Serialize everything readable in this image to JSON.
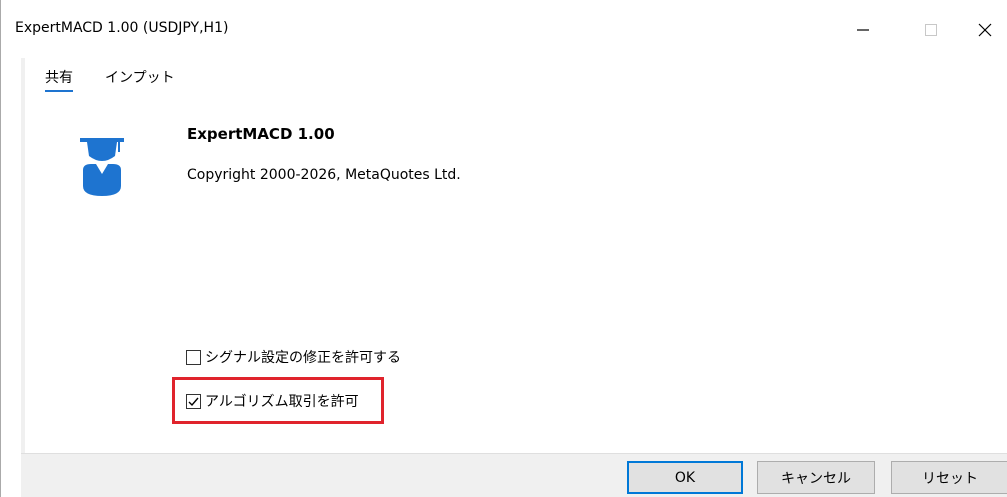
{
  "window": {
    "title": "ExpertMACD 1.00 (USDJPY,H1)",
    "controls": {
      "minimize": "—",
      "maximize": "☐",
      "close": "✕"
    }
  },
  "tabs": [
    {
      "label": "共有",
      "active": true
    },
    {
      "label": "インプット",
      "active": false
    }
  ],
  "expert": {
    "icon": "expert-advisor-icon",
    "name": "ExpertMACD 1.00",
    "copyright": "Copyright 2000-2026, MetaQuotes Ltd."
  },
  "options": {
    "signal": {
      "label": "シグナル設定の修正を許可する",
      "checked": false
    },
    "algo": {
      "label": "アルゴリズム取引を許可",
      "checked": true
    }
  },
  "buttons": {
    "ok": "OK",
    "cancel": "キャンセル",
    "reset": "リセット"
  },
  "colors": {
    "accent": "#1e74d0",
    "highlight": "#e0232c",
    "icon": "#1e74d0"
  }
}
